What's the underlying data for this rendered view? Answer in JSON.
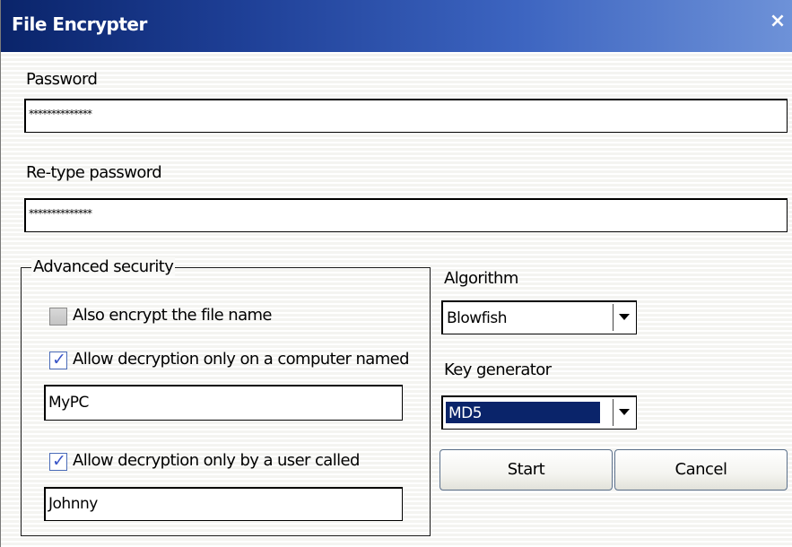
{
  "window": {
    "title": "File Encrypter",
    "close_glyph": "×"
  },
  "password": {
    "label": "Password",
    "value": "**************"
  },
  "retype": {
    "label": "Re-type password",
    "value": "**************"
  },
  "advanced": {
    "legend": "Advanced security",
    "encrypt_filename": {
      "label": "Also encrypt the file name",
      "checked": false
    },
    "computer_restrict": {
      "label": "Allow decryption only on a computer named",
      "checked": true,
      "value": "MyPC"
    },
    "user_restrict": {
      "label": "Allow decryption only by a user called",
      "checked": true,
      "value": "Johnny"
    }
  },
  "algorithm": {
    "label": "Algorithm",
    "selected": "Blowfish"
  },
  "keygen": {
    "label": "Key generator",
    "selected": "MD5"
  },
  "buttons": {
    "start": "Start",
    "cancel": "Cancel"
  },
  "icons": {
    "close": "close-icon",
    "check": "checkmark-icon",
    "dropdown": "chevron-down-icon"
  },
  "colors": {
    "titlebar_dark": "#0a246a",
    "titlebar_light": "#6e92d8",
    "selection": "#0a246a",
    "checkmark": "#3a56c8"
  }
}
